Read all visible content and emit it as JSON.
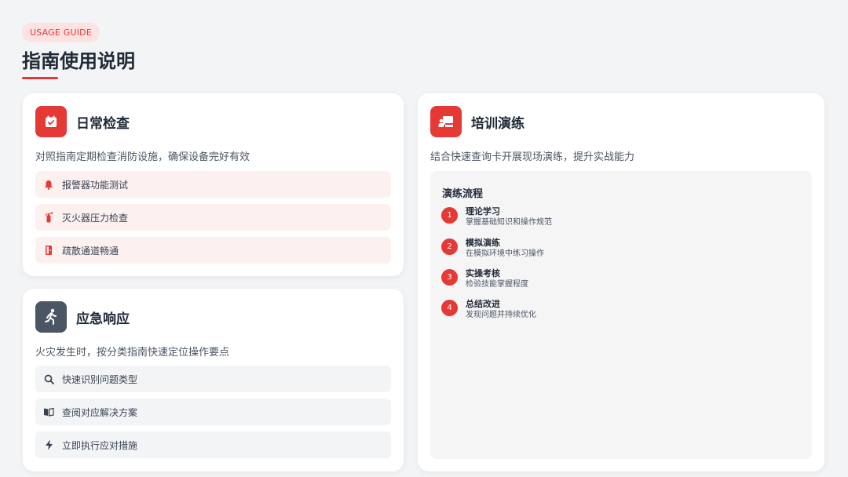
{
  "header": {
    "badge": "USAGE GUIDE",
    "title": "指南使用说明"
  },
  "colors": {
    "accent": "#e53935",
    "accent_light": "#fdf1f0",
    "slate": "#4b5563",
    "background": "#f3f4f6"
  },
  "daily_check": {
    "icon": "calendar-check-icon",
    "title": "日常检查",
    "description": "对照指南定期检查消防设施，确保设备完好有效",
    "items": [
      {
        "icon": "bell-icon",
        "label": "报警器功能测试"
      },
      {
        "icon": "fire-extinguisher-icon",
        "label": "灭火器压力检查"
      },
      {
        "icon": "door-icon",
        "label": "疏散通道畅通"
      }
    ]
  },
  "emergency": {
    "icon": "running-person-icon",
    "title": "应急响应",
    "description": "火灾发生时，按分类指南快速定位操作要点",
    "items": [
      {
        "icon": "search-icon",
        "label": "快速识别问题类型"
      },
      {
        "icon": "book-icon",
        "label": "查阅对应解决方案"
      },
      {
        "icon": "lightning-icon",
        "label": "立即执行应对措施"
      }
    ]
  },
  "training": {
    "icon": "presentation-icon",
    "title": "培训演练",
    "description": "结合快速查询卡开展现场演练，提升实战能力",
    "flow_title": "演练流程",
    "steps": [
      {
        "num": "1",
        "title": "理论学习",
        "desc": "掌握基础知识和操作规范"
      },
      {
        "num": "2",
        "title": "模拟演练",
        "desc": "在模拟环境中练习操作"
      },
      {
        "num": "3",
        "title": "实操考核",
        "desc": "检验技能掌握程度"
      },
      {
        "num": "4",
        "title": "总结改进",
        "desc": "发现问题并持续优化"
      }
    ]
  }
}
